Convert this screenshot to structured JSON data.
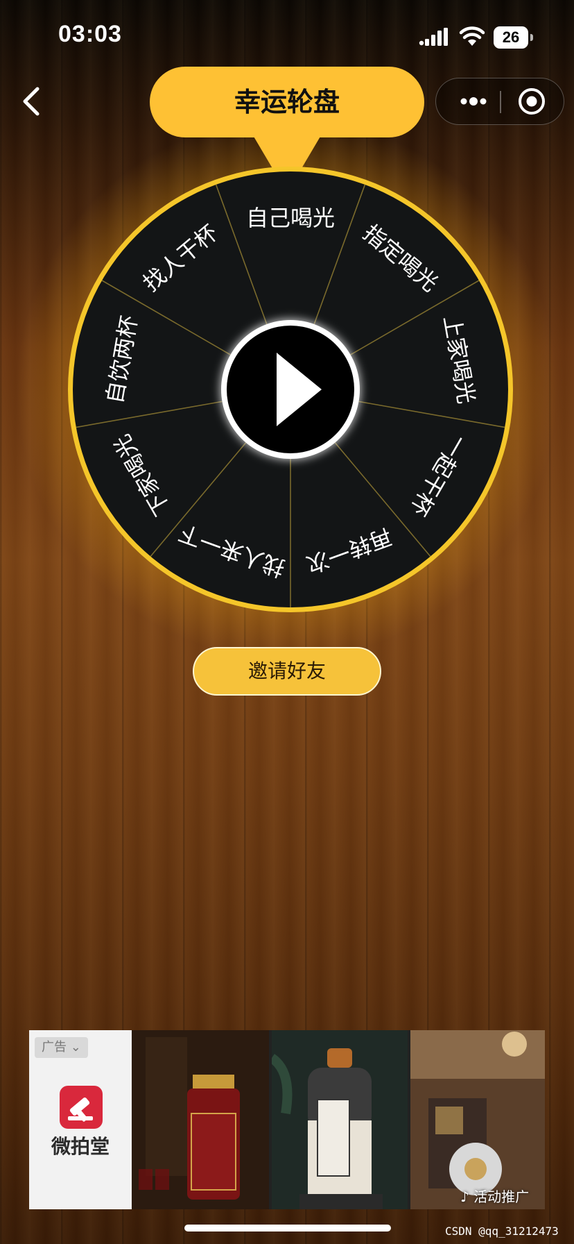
{
  "status_bar": {
    "time": "03:03",
    "battery": "26"
  },
  "header": {
    "title": "幸运轮盘"
  },
  "wheel": {
    "segments": [
      "自己喝光",
      "指定喝光",
      "上家喝光",
      "一起干杯",
      "再转一次",
      "找人来一下",
      "下家喝光",
      "自饮两杯",
      "找人干杯"
    ],
    "play_icon": "play-icon",
    "rim_color": "#f5c62a",
    "segment_color": "#131516",
    "divider_color": "#7a6a2c"
  },
  "actions": {
    "invite_label": "邀请好友"
  },
  "ad": {
    "tag": "广告",
    "brand": "微拍堂",
    "promo": "活动推广"
  },
  "watermark": "CSDN @qq_31212473"
}
